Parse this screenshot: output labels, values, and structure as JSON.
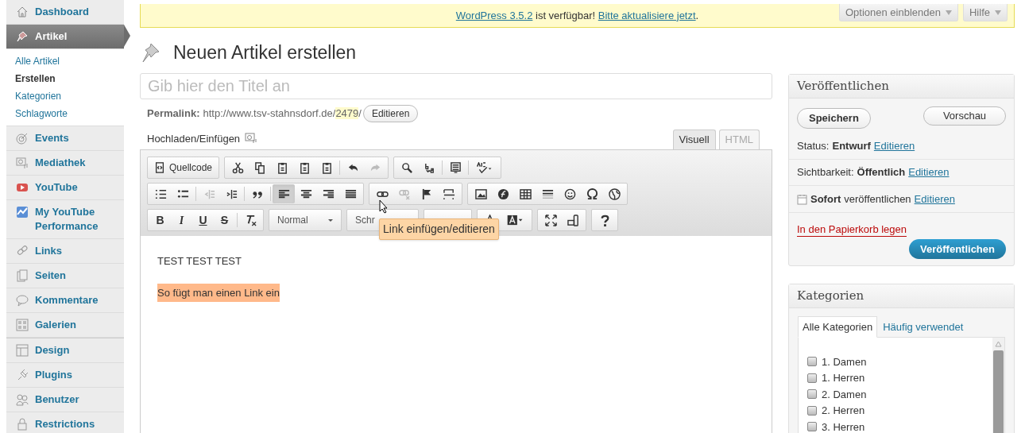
{
  "sidebar": {
    "items": [
      {
        "label": "Dashboard",
        "selected": false
      },
      {
        "label": "Artikel",
        "selected": true,
        "children": [
          {
            "label": "Alle Artikel",
            "selected": false
          },
          {
            "label": "Erstellen",
            "selected": true
          },
          {
            "label": "Kategorien",
            "selected": false
          },
          {
            "label": "Schlagworte",
            "selected": false
          }
        ]
      },
      {
        "label": "Events",
        "selected": false
      },
      {
        "label": "Mediathek",
        "selected": false
      },
      {
        "label": "YouTube",
        "selected": false
      },
      {
        "label": "My YouTube Performance",
        "selected": false
      },
      {
        "label": "Links",
        "selected": false
      },
      {
        "label": "Seiten",
        "selected": false
      },
      {
        "label": "Kommentare",
        "selected": false
      },
      {
        "label": "Galerien",
        "selected": false
      },
      {
        "label": "Design",
        "selected": false
      },
      {
        "label": "Plugins",
        "selected": false
      },
      {
        "label": "Benutzer",
        "selected": false
      },
      {
        "label": "Restrictions",
        "selected": false
      }
    ]
  },
  "notice": {
    "link": "WordPress 3.5.2",
    "text": "ist verfügbar!",
    "action": "Bitte aktualisiere jetzt",
    "end": "."
  },
  "screen_buttons": [
    "Optionen einblenden",
    "Hilfe"
  ],
  "page_title": "Neuen Artikel erstellen",
  "title_field": {
    "placeholder": "Gib hier den Titel an"
  },
  "permalink": {
    "label": "Permalink:",
    "url": "http://www.tsv-stahnsdorf.de/",
    "slug": "2479",
    "end": "/",
    "button": "Editieren"
  },
  "media": {
    "label": "Hochladen/Einfügen"
  },
  "editor_tabs": [
    {
      "label": "Visuell",
      "selected": true
    },
    {
      "label": "HTML",
      "selected": false
    }
  ],
  "toolbar": [
    [
      [
        {
          "kind": "source",
          "label": "Quellcode",
          "disabled": false,
          "pressed": false
        }
      ],
      [
        {
          "kind": "cut",
          "disabled": false,
          "pressed": false
        },
        {
          "kind": "copy",
          "disabled": false,
          "pressed": false
        },
        {
          "kind": "paste",
          "disabled": false,
          "pressed": false
        },
        {
          "kind": "paste",
          "disabled": false,
          "pressed": false
        },
        {
          "kind": "paste",
          "disabled": false,
          "pressed": false
        },
        {
          "kind": "sep"
        },
        {
          "kind": "undo",
          "disabled": false,
          "pressed": false
        },
        {
          "kind": "redo",
          "disabled": true,
          "pressed": false
        }
      ],
      [
        {
          "kind": "find",
          "disabled": false,
          "pressed": false
        },
        {
          "kind": "replace",
          "disabled": false,
          "pressed": false
        },
        {
          "kind": "sep"
        },
        {
          "kind": "blocks",
          "disabled": false,
          "pressed": false
        },
        {
          "kind": "sep"
        },
        {
          "kind": "spell",
          "disabled": false,
          "pressed": false
        }
      ]
    ],
    [
      [
        {
          "kind": "ol",
          "disabled": false,
          "pressed": false
        },
        {
          "kind": "ul",
          "disabled": false,
          "pressed": false
        },
        {
          "kind": "sep"
        },
        {
          "kind": "outdent",
          "disabled": true,
          "pressed": false
        },
        {
          "kind": "indent",
          "disabled": false,
          "pressed": false
        },
        {
          "kind": "sep"
        },
        {
          "kind": "quote",
          "disabled": false,
          "pressed": false
        },
        {
          "kind": "sep"
        },
        {
          "kind": "left",
          "disabled": false,
          "pressed": true
        },
        {
          "kind": "center",
          "disabled": false,
          "pressed": false
        },
        {
          "kind": "right",
          "disabled": false,
          "pressed": false
        },
        {
          "kind": "justify",
          "disabled": false,
          "pressed": false
        }
      ],
      [
        {
          "kind": "link",
          "disabled": false,
          "pressed": false
        },
        {
          "kind": "unlink",
          "disabled": true,
          "pressed": false
        },
        {
          "kind": "flag",
          "disabled": false,
          "pressed": false
        },
        {
          "kind": "more",
          "disabled": false,
          "pressed": false
        }
      ],
      [
        {
          "kind": "image",
          "disabled": false,
          "pressed": false
        },
        {
          "kind": "flash",
          "disabled": false,
          "pressed": false
        },
        {
          "kind": "table",
          "disabled": false,
          "pressed": false
        },
        {
          "kind": "hr",
          "disabled": false,
          "pressed": false
        },
        {
          "kind": "smiley",
          "disabled": false,
          "pressed": false
        },
        {
          "kind": "omega",
          "disabled": false,
          "pressed": false
        },
        {
          "kind": "globe",
          "disabled": false,
          "pressed": false
        }
      ]
    ],
    [
      [
        {
          "kind": "text",
          "label": "B",
          "disabled": false,
          "pressed": false
        },
        {
          "kind": "text",
          "label": "I",
          "disabled": false,
          "pressed": false
        },
        {
          "kind": "text",
          "label": "U",
          "disabled": false,
          "pressed": false
        },
        {
          "kind": "text",
          "label": "S",
          "disabled": false,
          "pressed": false
        },
        {
          "kind": "sep"
        },
        {
          "kind": "clear",
          "disabled": false,
          "pressed": false
        }
      ],
      [
        {
          "kind": "select",
          "label": "Normal"
        }
      ],
      [
        {
          "kind": "select",
          "label": "Schr"
        }
      ],
      [
        {
          "kind": "select"
        }
      ],
      [
        {
          "kind": "color",
          "disabled": false,
          "pressed": false
        },
        {
          "kind": "bgcolor",
          "disabled": false,
          "pressed": false
        }
      ],
      [
        {
          "kind": "fullscreen",
          "disabled": false,
          "pressed": false
        },
        {
          "kind": "mobile",
          "disabled": false,
          "pressed": false
        }
      ],
      [
        {
          "kind": "help",
          "disabled": false,
          "pressed": false
        }
      ]
    ]
  ],
  "tooltip": "Link einfügen/editieren",
  "content": [
    {
      "text": "TEST TEST TEST",
      "highlighted": false
    },
    {
      "text": "So fügt man einen Link ein",
      "highlighted": true
    }
  ],
  "publish": {
    "title": "Veröffentlichen",
    "save": "Speichern",
    "preview": "Vorschau",
    "rows": [
      {
        "label": "Status:",
        "value": "Entwurf",
        "link": "Editieren"
      },
      {
        "label": "Sichtbarkeit:",
        "value": "Öffentlich",
        "link": "Editieren"
      },
      {
        "value": "Sofort",
        "label": "veröffentlichen",
        "link": "Editieren"
      }
    ],
    "trash": "In den Papierkorb legen",
    "publish": "Veröffentlichen"
  },
  "categories": {
    "title": "Kategorien",
    "tabs": [
      {
        "label": "Alle Kategorien",
        "selected": true
      },
      {
        "label": "Häufig verwendet",
        "selected": false
      }
    ],
    "items": [
      {
        "label": "1. Damen",
        "checked": false
      },
      {
        "label": "1. Herren",
        "checked": false
      },
      {
        "label": "2. Damen",
        "checked": false
      },
      {
        "label": "2. Herren",
        "checked": false
      },
      {
        "label": "3. Herren",
        "checked": false
      }
    ]
  }
}
